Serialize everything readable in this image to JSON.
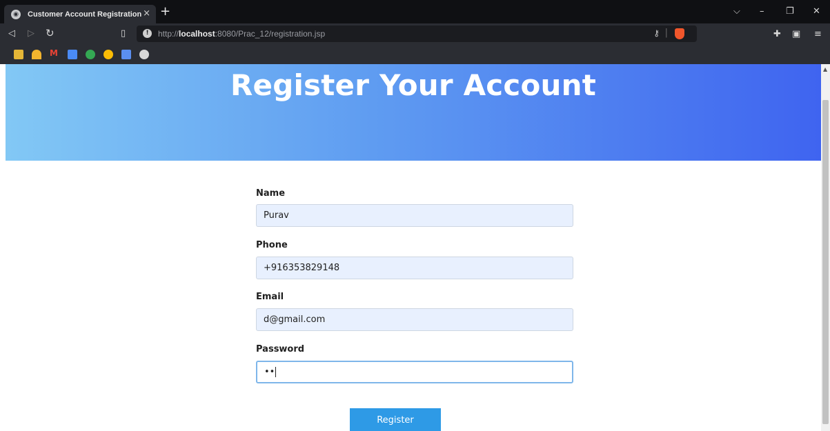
{
  "browser": {
    "tab_title": "Customer Account Registration",
    "tab_close": "×",
    "new_tab": "+",
    "url_scheme": "http://",
    "url_host": "localhost",
    "url_rest": ":8080/Prac_12/registration.jsp",
    "window": {
      "minimize": "–",
      "restore": "❐",
      "close": "✕",
      "dropdown": "⌵"
    }
  },
  "page": {
    "heading": "Register Your Account",
    "form": {
      "name_label": "Name",
      "name_value": "Purav",
      "phone_label": "Phone",
      "phone_value": "+916353829148",
      "email_label": "Email",
      "email_value": "d@gmail.com",
      "password_label": "Password",
      "password_value": "••",
      "submit_label": "Register"
    }
  },
  "colors": {
    "hero_start": "#82c8f5",
    "hero_end": "#3f64f0",
    "button": "#2e9ae6",
    "field_bg": "#e8f0fe"
  }
}
